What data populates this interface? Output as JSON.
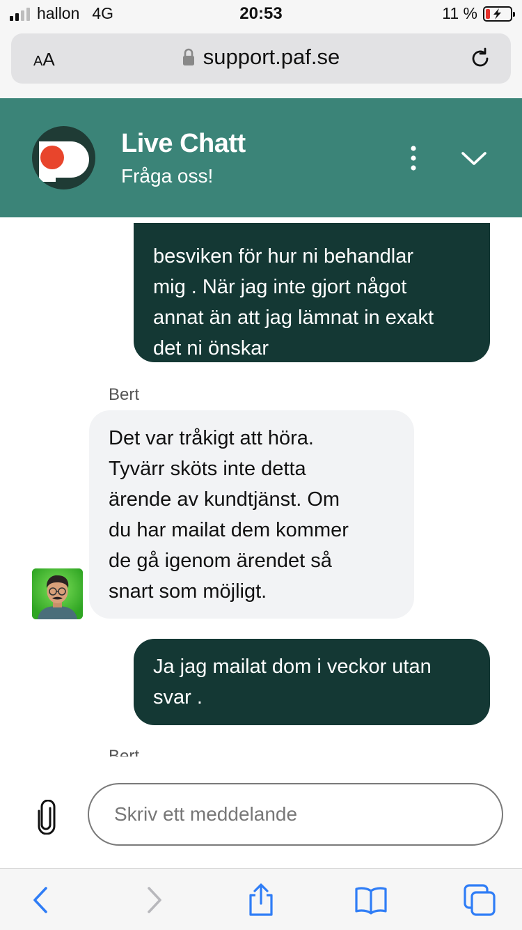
{
  "status_bar": {
    "carrier": "hallon",
    "network": "4G",
    "time": "20:53",
    "battery_percent": "11 %",
    "battery_level": 0.11,
    "signal_bars_active": 2,
    "signal_bars_total": 4
  },
  "browser": {
    "text_size_label_small": "A",
    "text_size_label_large": "A",
    "url": "support.paf.se"
  },
  "chat": {
    "title": "Live Chatt",
    "subtitle": "Fråga oss!",
    "messages": [
      {
        "from": "user",
        "lines": [
          "besviken för hur ni behandlar",
          "mig . När jag inte gjort något",
          "annat än att jag lämnat in exakt",
          "det ni önskar"
        ]
      },
      {
        "from": "agent",
        "name": "Bert",
        "lines": [
          "Det var tråkigt att höra.",
          "Tyvärr sköts inte detta",
          "ärende av kundtjänst. Om",
          "du har mailat dem kommer",
          "de gå igenom ärendet så",
          "snart som möjligt."
        ]
      },
      {
        "from": "user",
        "lines": [
          "Ja jag mailat dom i veckor utan",
          "svar ."
        ]
      },
      {
        "from": "agent",
        "name": "Bert"
      }
    ]
  },
  "composer": {
    "placeholder": "Skriv ett meddelande"
  },
  "colors": {
    "header": "#3b8478",
    "user_bubble": "#143834",
    "agent_bubble": "#f2f3f5",
    "brand_red": "#e8452c",
    "ios_blue": "#2f7df6"
  },
  "icons": [
    "signal-icon",
    "lock-icon",
    "reload-icon",
    "paf-logo",
    "more-icon",
    "chevron-down-icon",
    "agent-avatar",
    "paperclip-icon",
    "back-icon",
    "forward-icon",
    "share-icon",
    "bookmarks-icon",
    "tabs-icon"
  ]
}
